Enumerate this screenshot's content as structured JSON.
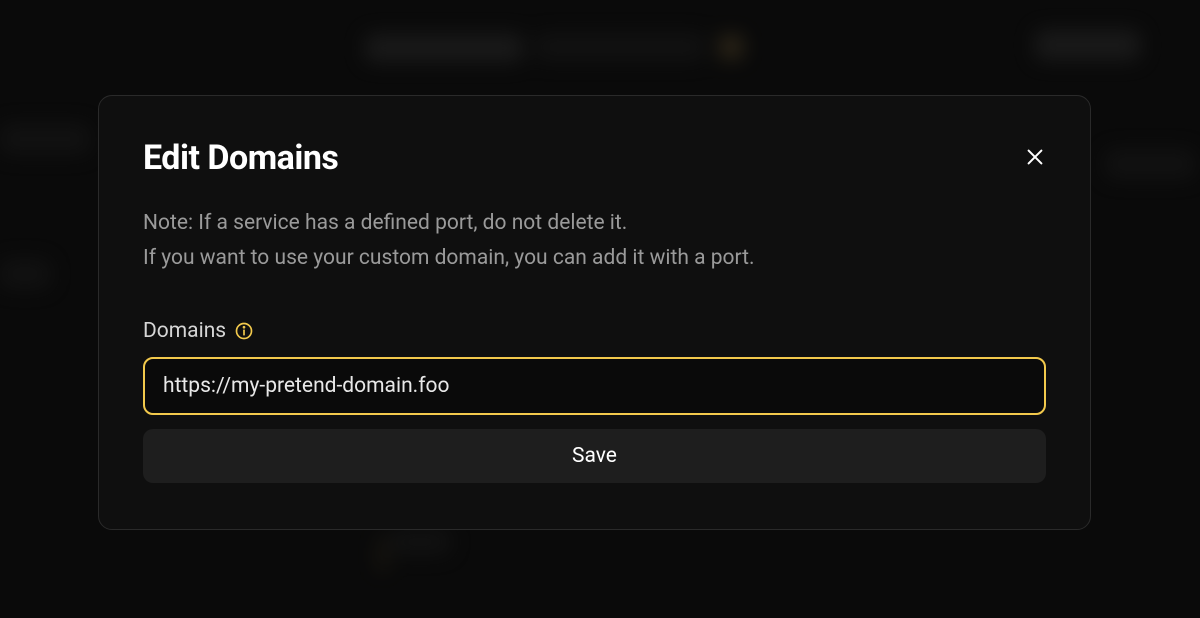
{
  "modal": {
    "title": "Edit Domains",
    "description_line1": "Note: If a service has a defined port, do not delete it.",
    "description_line2": "If you want to use your custom domain, you can add it with a port.",
    "field_label": "Domains",
    "input_value": "https://my-pretend-domain.foo",
    "save_label": "Save"
  },
  "colors": {
    "accent": "#f2c94c",
    "modal_bg": "#0f0f0f",
    "page_bg": "#0a0a0a"
  }
}
